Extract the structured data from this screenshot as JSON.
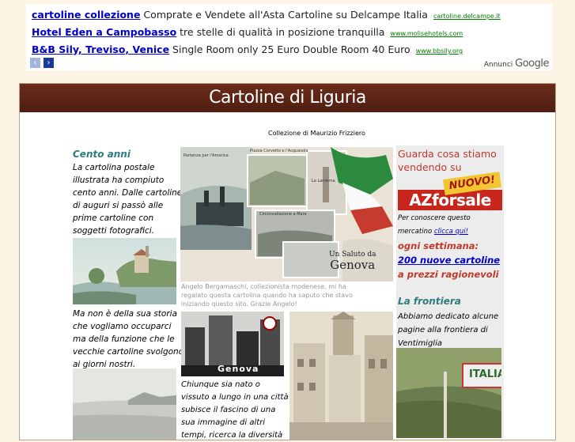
{
  "ads": [
    {
      "title": "cartoline collezione",
      "text": "Comprate e Vendete all'Asta Cartoline su Delcampe Italia",
      "url": "cartoline.delcampe.it"
    },
    {
      "title": "Hotel Eden a Campobasso",
      "text": "tre stelle di qualità in posizione tranquilla",
      "url": "www.molisehotels.com"
    },
    {
      "title": "B&B Sily, Treviso, Venice",
      "text": "Single Room only 25 Euro Double Room 40 Euro",
      "url": "www.bbsily.org"
    }
  ],
  "ad_nav": {
    "prev": "‹",
    "next": "›"
  },
  "ad_label": {
    "prefix": "Annunci",
    "brand": "Google"
  },
  "banner_title": "Cartoline di Liguria",
  "credit": "Collezione di Maurizio Frizziero",
  "left": {
    "heading": "Cento anni",
    "para1": [
      "La cartolina postale",
      "illustrata ha compiuto",
      "cento anni. Dalle cartoline",
      "di auguri si passò alle",
      "prime cartoline con",
      "soggetti fotografici."
    ],
    "para2": [
      "Ma non è della sua storia",
      "che vogliamo occuparci",
      "ma della funzione che le",
      "vecchie cartoline svolgono",
      "ai giorni nostri."
    ]
  },
  "center": {
    "postcard_text": [
      "Un Saluto da",
      "Genova"
    ],
    "postcard_labels": [
      "Partenza per l'America",
      "Piazza Corvetto e l'Acquasola",
      "La Lanterna",
      "Circonvallazione a Mare"
    ],
    "caption": [
      "Angelo Bergamaschi, collezionista modenese, mi ha",
      "regalato questa cartolina quando ha saputo che stavo",
      "iniziando questo sito. Grazie Angelo!"
    ],
    "deco_label": "Genova",
    "para3": [
      "Chiunque sia nato o",
      "vissuto a lungo in una città",
      "subisce il fascino di una",
      "sua immagine di altri",
      "tempi, ricerca la diversità"
    ]
  },
  "right": {
    "promo": [
      "Guarda cosa stiamo",
      "vendendo su"
    ],
    "logo": "AZforsale",
    "logo_badge": "NUOVO!",
    "small1": "Per conoscere  questo",
    "small2a": "mercatino",
    "small2_link": "clicca qui!",
    "weekly": "ogni settimana:",
    "link1": "200 nuove cartoline",
    "weekly2": "a prezzi ragionevoli",
    "heading2": "La frontiera",
    "para": [
      "Abbiamo dedicato alcune",
      "pagine alla frontiera di",
      "Ventimiglia"
    ],
    "sign": "ITALIA"
  }
}
